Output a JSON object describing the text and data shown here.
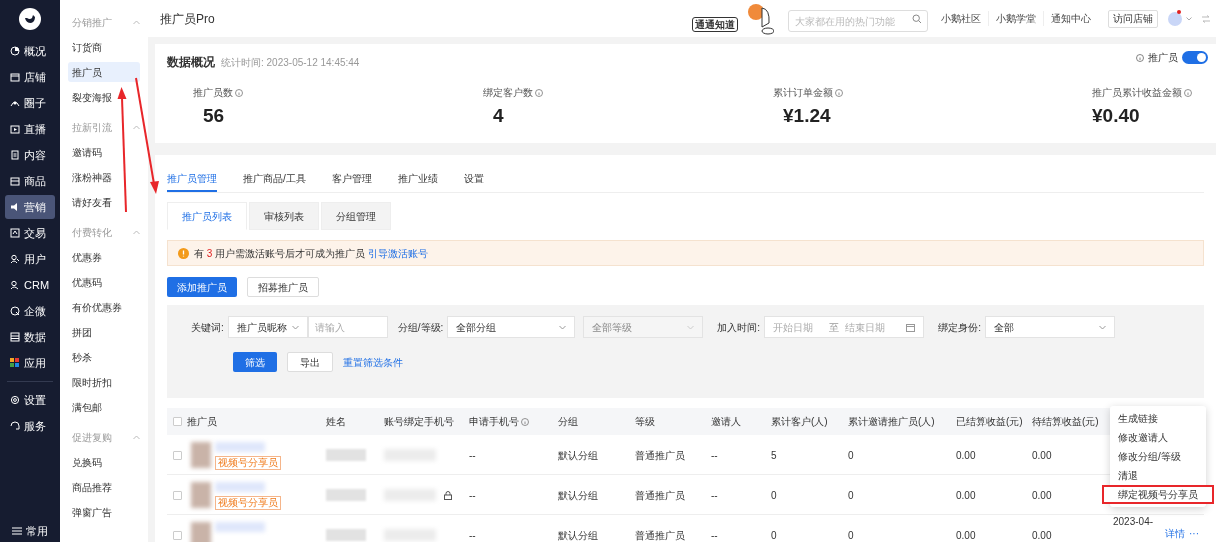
{
  "sidebar": {
    "items": [
      {
        "label": "概况",
        "selected": false
      },
      {
        "label": "店铺",
        "selected": false
      },
      {
        "label": "圈子",
        "selected": false
      },
      {
        "label": "直播",
        "selected": false
      },
      {
        "label": "内容",
        "selected": false
      },
      {
        "label": "商品",
        "selected": false
      },
      {
        "label": "营销",
        "selected": true
      },
      {
        "label": "交易",
        "selected": false
      },
      {
        "label": "用户",
        "selected": false
      },
      {
        "label": "CRM",
        "selected": false
      },
      {
        "label": "企微",
        "selected": false
      },
      {
        "label": "数据",
        "selected": false
      },
      {
        "label": "应用",
        "selected": false
      }
    ],
    "bottom_items": [
      {
        "label": "设置",
        "selected": false
      },
      {
        "label": "服务",
        "selected": false
      }
    ],
    "footer": "常用"
  },
  "subnav": [
    {
      "title": "分销推广",
      "expanded": true,
      "items": [
        {
          "label": "订货商",
          "selected": false
        },
        {
          "label": "推广员",
          "selected": true
        },
        {
          "label": "裂变海报",
          "selected": false
        }
      ]
    },
    {
      "title": "拉新引流",
      "expanded": true,
      "items": [
        {
          "label": "邀请码",
          "selected": false
        },
        {
          "label": "涨粉神器",
          "selected": false
        },
        {
          "label": "请好友看",
          "selected": false
        }
      ]
    },
    {
      "title": "付费转化",
      "expanded": true,
      "items": [
        {
          "label": "优惠券",
          "selected": false
        },
        {
          "label": "优惠码",
          "selected": false
        },
        {
          "label": "有价优惠券",
          "selected": false
        },
        {
          "label": "拼团",
          "selected": false
        },
        {
          "label": "秒杀",
          "selected": false
        },
        {
          "label": "限时折扣",
          "selected": false
        },
        {
          "label": "满包邮",
          "selected": false
        }
      ]
    },
    {
      "title": "促进复购",
      "expanded": true,
      "items": [
        {
          "label": "兑换码",
          "selected": false
        },
        {
          "label": "商品推荐",
          "selected": false
        },
        {
          "label": "弹窗广告",
          "selected": false
        }
      ]
    }
  ],
  "header": {
    "title": "推广员Pro",
    "mascot_label": "通通知道",
    "search": {
      "placeholder": "大家都在用的热门功能"
    },
    "links": [
      "小鹅社区",
      "小鹅学堂",
      "通知中心"
    ],
    "visit_button": "访问店铺",
    "notification_dot": true
  },
  "overview": {
    "title": "数据概况",
    "time": "统计时间: 2023-05-12 14:45:44",
    "toggle": {
      "label": "推广员",
      "on": true
    },
    "stats": [
      {
        "label": "推广员数",
        "value": "56"
      },
      {
        "label": "绑定客户数",
        "value": "4"
      },
      {
        "label": "累计订单金额",
        "value": "¥1.24"
      },
      {
        "label": "推广员累计收益金额",
        "value": "¥0.40"
      }
    ]
  },
  "tabs": [
    {
      "label": "推广员管理",
      "selected": true
    },
    {
      "label": "推广商品/工具",
      "selected": false
    },
    {
      "label": "客户管理",
      "selected": false
    },
    {
      "label": "推广业绩",
      "selected": false
    },
    {
      "label": "设置",
      "selected": false
    }
  ],
  "subtabs": [
    {
      "label": "推广员列表",
      "selected": true
    },
    {
      "label": "审核列表",
      "selected": false
    },
    {
      "label": "分组管理",
      "selected": false
    }
  ],
  "notice": {
    "before": "有",
    "count": "3",
    "after": "用户需激活账号后才可成为推广员",
    "link": "引导激活账号"
  },
  "actions": [
    "添加推广员",
    "招募推广员"
  ],
  "filters": {
    "keyword_label": "关键词:",
    "keyword_type": "推广员昵称",
    "keyword_placeholder": "请输入",
    "group_label": "分组/等级:",
    "group_value": "全部分组",
    "level_value": "全部等级",
    "level_disabled": true,
    "time_label": "加入时间:",
    "start_placeholder": "开始日期",
    "range_sep": "至",
    "end_placeholder": "结束日期",
    "identity_label": "绑定身份:",
    "identity_value": "全部",
    "submit": "筛选",
    "export": "导出",
    "reset": "重置筛选条件"
  },
  "table": {
    "header_checked": false,
    "columns": [
      "推广员",
      "姓名",
      "账号绑定手机号",
      "申请手机号",
      "分组",
      "等级",
      "邀请人",
      "累计客户(人)",
      "累计邀请推广员(人)",
      "已结算收益(元)",
      "待结算收益(元)"
    ],
    "rows": [
      {
        "checked": false,
        "badge": "视频号分享员",
        "phone_locked": false,
        "cells": [
          "",
          "",
          "",
          "--",
          "默认分组",
          "普通推广员",
          "--",
          "5",
          "0",
          "0.00",
          "0.00"
        ]
      },
      {
        "checked": false,
        "badge": "视频号分享员",
        "phone_locked": true,
        "cells": [
          "",
          "",
          "",
          "--",
          "默认分组",
          "普通推广员",
          "--",
          "0",
          "0",
          "0.00",
          "0.00"
        ]
      },
      {
        "checked": false,
        "phone_locked": false,
        "cells": [
          "",
          "",
          "",
          "--",
          "默认分组",
          "普通推广员",
          "--",
          "0",
          "0",
          "0.00",
          "0.00"
        ],
        "last_col": "2023-04-",
        "detail": "详情",
        "more": "···"
      }
    ]
  },
  "menu": {
    "items": [
      {
        "label": "生成链接",
        "highlighted": false
      },
      {
        "label": "修改邀请人",
        "highlighted": false
      },
      {
        "label": "修改分组/等级",
        "highlighted": false
      },
      {
        "label": "清退",
        "highlighted": false
      },
      {
        "label": "绑定视频号分享员",
        "highlighted": true
      }
    ]
  }
}
